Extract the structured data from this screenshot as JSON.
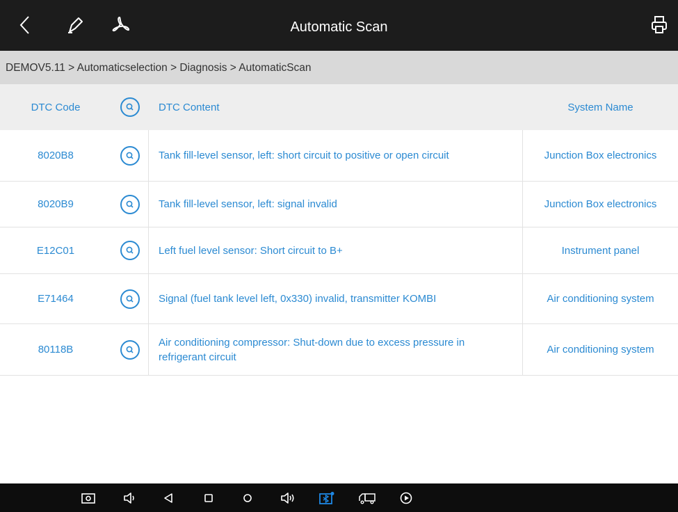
{
  "header": {
    "title": "Automatic Scan",
    "icons": [
      "back-icon",
      "pen-icon",
      "pdf-icon",
      "printer-icon"
    ]
  },
  "breadcrumb": "DEMOV5.11 > Automaticselection > Diagnosis > AutomaticScan",
  "table": {
    "columns": {
      "code": "DTC Code",
      "content": "DTC Content",
      "system": "System Name"
    },
    "rows": [
      {
        "code": "8020B8",
        "content": "Tank fill-level sensor, left: short circuit to positive or open circuit",
        "system": "Junction Box electronics"
      },
      {
        "code": "8020B9",
        "content": "Tank fill-level sensor, left: signal invalid",
        "system": "Junction Box electronics"
      },
      {
        "code": "E12C01",
        "content": "Left fuel level sensor: Short circuit to B+",
        "system": "Instrument panel"
      },
      {
        "code": "E71464",
        "content": "Signal (fuel tank level left, 0x330) invalid, transmitter KOMBI",
        "system": "Air conditioning system"
      },
      {
        "code": "80118B",
        "content": "Air conditioning compressor: Shut-down due to excess pressure in refrigerant circuit",
        "system": "Air conditioning system"
      }
    ]
  },
  "colors": {
    "topbar": "#1c1c1c",
    "breadcrumb_bg": "#d9d9d9",
    "header_row_bg": "#eeeeee",
    "accent_text": "#2b8ad2",
    "navbar": "#0d0d0d",
    "vci_icon": "#1e88e5"
  },
  "navbar_icons": [
    "screenshot-icon",
    "volume-down-icon",
    "nav-back-icon",
    "nav-recents-icon",
    "nav-home-icon",
    "volume-up-icon",
    "vci-icon",
    "truck-icon",
    "play-icon"
  ]
}
